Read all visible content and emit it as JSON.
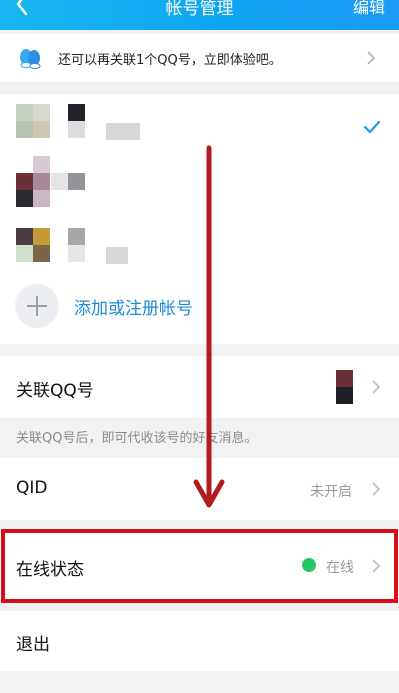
{
  "header": {
    "back_icon": "back-arrow-icon",
    "title": "帐号管理",
    "edit_label": "编辑"
  },
  "banner": {
    "icon": "qq-penguins-icon",
    "text": "还可以再关联1个QQ号，立即体验吧。",
    "chevron_icon": "chevron-right-icon"
  },
  "accounts": {
    "selected_index": 0,
    "items": [
      {
        "avatar": "blurred-avatar-1",
        "selected": true
      },
      {
        "avatar": "blurred-avatar-2",
        "selected": false
      },
      {
        "avatar": "blurred-avatar-3",
        "selected": false
      }
    ],
    "add_label": "添加或注册帐号"
  },
  "link_qq": {
    "label": "关联QQ号",
    "note": "关联QQ号后，即可代收该号的好友消息。"
  },
  "qid": {
    "label": "QID",
    "value": "未开启"
  },
  "online_status": {
    "label": "在线状态",
    "value": "在线",
    "status_color": "#23c660"
  },
  "logout": {
    "label": "退出"
  },
  "colors": {
    "accent": "#10a5f3",
    "link": "#1e8ad6",
    "highlight_border": "#d40f17",
    "annotation_arrow": "#b51a1f"
  }
}
